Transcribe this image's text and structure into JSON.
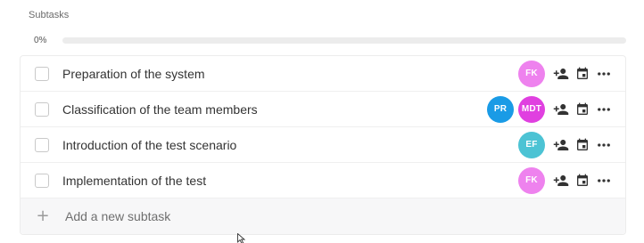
{
  "section": {
    "title": "Subtasks"
  },
  "progress": {
    "label": "0%",
    "value": 0
  },
  "tasks": [
    {
      "label": "Preparation of the system",
      "assignees": [
        {
          "initials": "FK",
          "color": "#ee82ee"
        }
      ]
    },
    {
      "label": "Classification of the team members",
      "assignees": [
        {
          "initials": "PR",
          "color": "#1a9be6"
        },
        {
          "initials": "MDT",
          "color": "#e040e0"
        }
      ]
    },
    {
      "label": "Introduction of the test scenario",
      "assignees": [
        {
          "initials": "EF",
          "color": "#4cc3d4"
        }
      ]
    },
    {
      "label": "Implementation of the test",
      "assignees": [
        {
          "initials": "FK",
          "color": "#ee82ee"
        }
      ]
    }
  ],
  "row_actions": [
    "add-person-icon",
    "calendar-icon",
    "more-icon"
  ],
  "add_subtask": {
    "label": "Add a new subtask",
    "icon": "plus-icon"
  },
  "colors": {
    "accent": "#7b68ee",
    "icon": "#333333"
  }
}
